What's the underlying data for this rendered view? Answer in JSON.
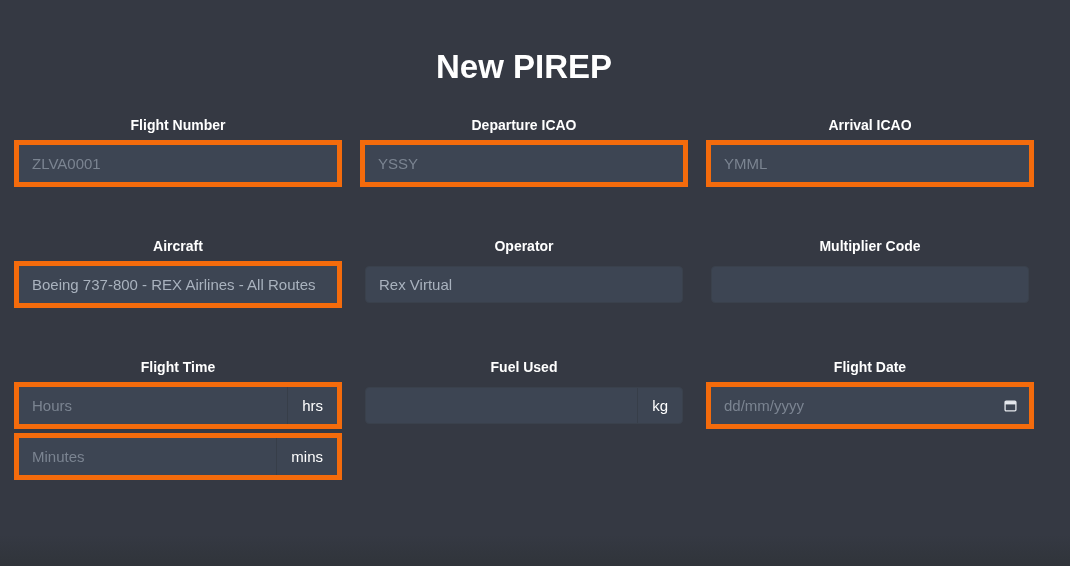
{
  "title": "New PIREP",
  "rows": [
    [
      {
        "label": "Flight Number",
        "inputs": [
          {
            "kind": "text",
            "placeholder": "ZLVA0001",
            "highlighted": true
          }
        ]
      },
      {
        "label": "Departure ICAO",
        "inputs": [
          {
            "kind": "text",
            "placeholder": "YSSY",
            "highlighted": true
          }
        ]
      },
      {
        "label": "Arrival ICAO",
        "inputs": [
          {
            "kind": "text",
            "placeholder": "YMML",
            "highlighted": true
          }
        ]
      }
    ],
    [
      {
        "label": "Aircraft",
        "inputs": [
          {
            "kind": "text",
            "value": "Boeing 737-800 - REX Airlines - All Routes",
            "highlighted": true
          }
        ]
      },
      {
        "label": "Operator",
        "inputs": [
          {
            "kind": "text",
            "value": "Rex Virtual",
            "highlighted": false
          }
        ]
      },
      {
        "label": "Multiplier Code",
        "inputs": [
          {
            "kind": "text",
            "highlighted": false
          }
        ]
      }
    ],
    [
      {
        "label": "Flight Time",
        "inputs": [
          {
            "kind": "unit",
            "placeholder": "Hours",
            "unit": "hrs",
            "highlighted": true
          },
          {
            "kind": "unit",
            "placeholder": "Minutes",
            "unit": "mins",
            "highlighted": true
          }
        ]
      },
      {
        "label": "Fuel Used",
        "inputs": [
          {
            "kind": "unit",
            "unit": "kg",
            "highlighted": false
          }
        ]
      },
      {
        "label": "Flight Date",
        "inputs": [
          {
            "kind": "date",
            "placeholder": "dd/mm/yyyy",
            "highlighted": true
          }
        ]
      }
    ]
  ]
}
